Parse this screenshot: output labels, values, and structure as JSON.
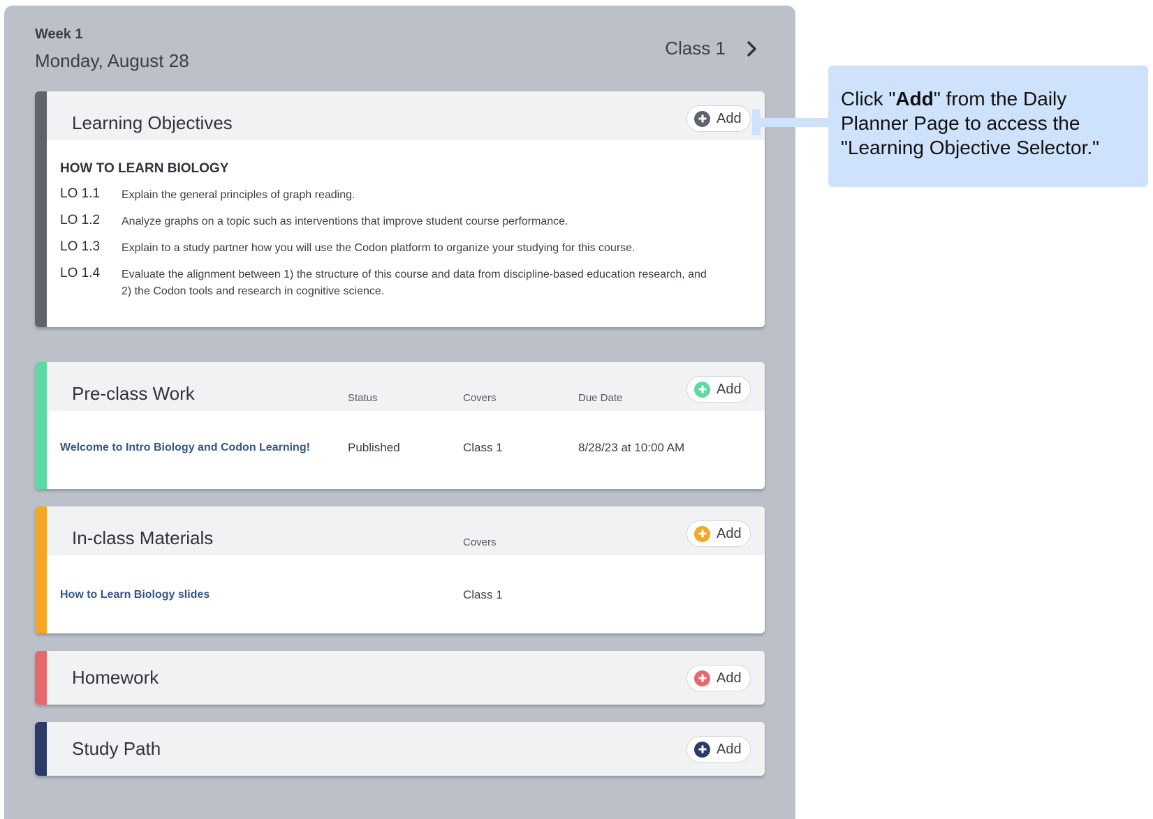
{
  "header": {
    "week": "Week 1",
    "date": "Monday, August 28",
    "class_nav": "Class 1"
  },
  "colors": {
    "learning_objectives": "#5f646b",
    "pre_class": "#5fd9a4",
    "in_class": "#f6a623",
    "homework": "#e8676b",
    "study_path": "#2b3a67"
  },
  "add_label": "Add",
  "learning_objectives": {
    "title": "Learning Objectives",
    "section": "HOW TO LEARN BIOLOGY",
    "items": [
      {
        "num": "LO 1.1",
        "text": "Explain the general principles of graph reading."
      },
      {
        "num": "LO 1.2",
        "text": "Analyze graphs on a topic such as interventions that improve student course performance."
      },
      {
        "num": "LO 1.3",
        "text": "Explain to a study partner how you will use the Codon platform to organize your studying for this course."
      },
      {
        "num": "LO 1.4",
        "text": "Evaluate the alignment between 1) the structure of this course and data from discipline-based education research, and 2) the Codon tools and research in cognitive science."
      }
    ]
  },
  "pre_class": {
    "title": "Pre-class Work",
    "columns": {
      "status": "Status",
      "covers": "Covers",
      "due": "Due Date"
    },
    "rows": [
      {
        "name": "Welcome to Intro Biology and Codon Learning!",
        "status": "Published",
        "covers": "Class 1",
        "due": "8/28/23 at 10:00 AM"
      }
    ]
  },
  "in_class": {
    "title": "In-class Materials",
    "columns": {
      "covers": "Covers"
    },
    "rows": [
      {
        "name": "How to Learn Biology slides",
        "covers": "Class 1"
      }
    ]
  },
  "homework": {
    "title": "Homework"
  },
  "study_path": {
    "title": "Study Path"
  },
  "callout": {
    "prefix": "Click \"",
    "bold": "Add",
    "suffix": "\" from the Daily Planner Page to access the \"Learning Objective Selector.\""
  }
}
